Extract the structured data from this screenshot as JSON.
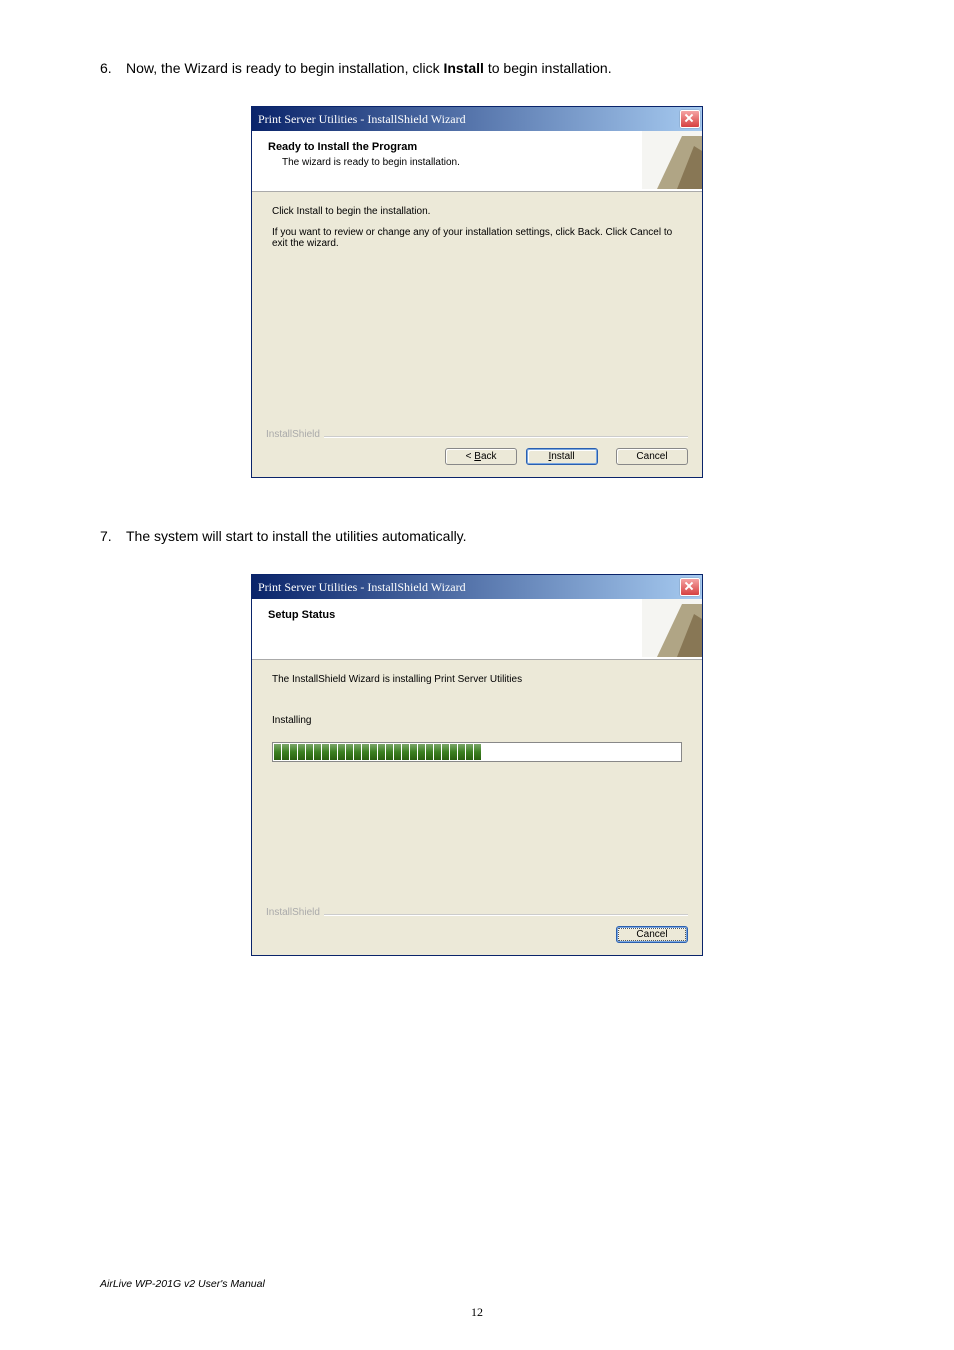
{
  "step6": {
    "prefix": "6.",
    "text_a": "Now, the Wizard is ready to begin installation, click ",
    "bold": "Install",
    "text_b": " to begin installation."
  },
  "step7": {
    "prefix": "7.",
    "text": "The system will start to install the utilities automatically."
  },
  "dialog1": {
    "title": "Print Server Utilities - InstallShield Wizard",
    "header_title": "Ready to Install the Program",
    "header_sub": "The wizard is ready to begin installation.",
    "body_line1": "Click Install to begin the installation.",
    "body_line2": "If you want to review or change any of your installation settings, click Back. Click Cancel to exit the wizard.",
    "brand": "InstallShield",
    "back_pre": "< ",
    "back_u": "B",
    "back_post": "ack",
    "install_u": "I",
    "install_post": "nstall",
    "cancel": "Cancel"
  },
  "dialog2": {
    "title": "Print Server Utilities - InstallShield Wizard",
    "header_title": "Setup Status",
    "body_line1": "The InstallShield Wizard is installing Print Server Utilities",
    "status": "Installing",
    "brand": "InstallShield",
    "cancel": "Cancel"
  },
  "footer": "AirLive WP-201G v2 User's Manual",
  "pagenum": "12"
}
